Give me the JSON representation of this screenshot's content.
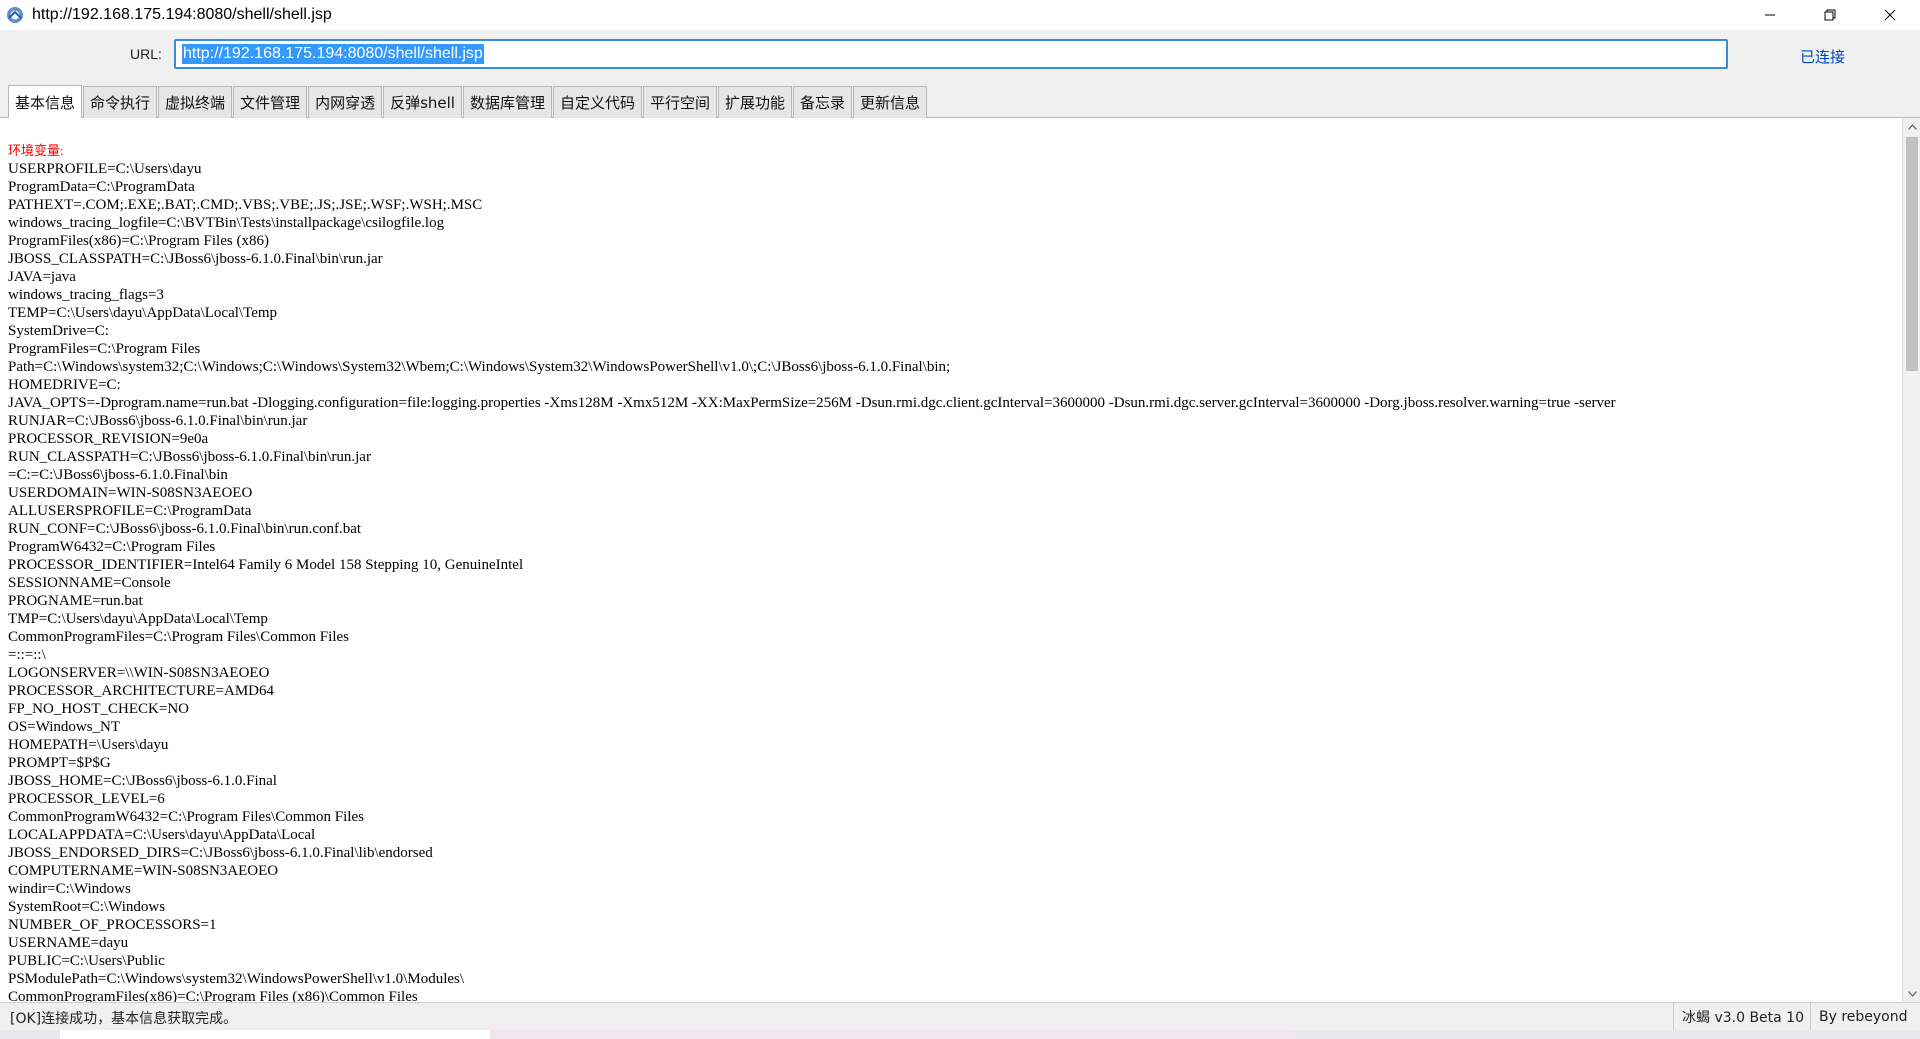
{
  "window": {
    "title": "http://192.168.175.194:8080/shell/shell.jsp"
  },
  "urlbar": {
    "label": "URL:",
    "value": "http://192.168.175.194:8080/shell/shell.jsp",
    "status": "已连接"
  },
  "tabs": [
    {
      "label": "基本信息",
      "active": true
    },
    {
      "label": "命令执行",
      "active": false
    },
    {
      "label": "虚拟终端",
      "active": false
    },
    {
      "label": "文件管理",
      "active": false
    },
    {
      "label": "内网穿透",
      "active": false
    },
    {
      "label": "反弹shell",
      "active": false
    },
    {
      "label": "数据库管理",
      "active": false
    },
    {
      "label": "自定义代码",
      "active": false
    },
    {
      "label": "平行空间",
      "active": false
    },
    {
      "label": "扩展功能",
      "active": false
    },
    {
      "label": "备忘录",
      "active": false
    },
    {
      "label": "更新信息",
      "active": false
    }
  ],
  "content": {
    "section_title": "环境变量:",
    "env_vars": [
      "USERPROFILE=C:\\Users\\dayu",
      "ProgramData=C:\\ProgramData",
      "PATHEXT=.COM;.EXE;.BAT;.CMD;.VBS;.VBE;.JS;.JSE;.WSF;.WSH;.MSC",
      "windows_tracing_logfile=C:\\BVTBin\\Tests\\installpackage\\csilogfile.log",
      "ProgramFiles(x86)=C:\\Program Files (x86)",
      "JBOSS_CLASSPATH=C:\\JBoss6\\jboss-6.1.0.Final\\bin\\run.jar",
      "JAVA=java",
      "windows_tracing_flags=3",
      "TEMP=C:\\Users\\dayu\\AppData\\Local\\Temp",
      "SystemDrive=C:",
      "ProgramFiles=C:\\Program Files",
      "Path=C:\\Windows\\system32;C:\\Windows;C:\\Windows\\System32\\Wbem;C:\\Windows\\System32\\WindowsPowerShell\\v1.0\\;C:\\JBoss6\\jboss-6.1.0.Final\\bin;",
      "HOMEDRIVE=C:",
      "JAVA_OPTS=-Dprogram.name=run.bat -Dlogging.configuration=file:logging.properties -Xms128M -Xmx512M -XX:MaxPermSize=256M -Dsun.rmi.dgc.client.gcInterval=3600000 -Dsun.rmi.dgc.server.gcInterval=3600000 -Dorg.jboss.resolver.warning=true -server",
      "RUNJAR=C:\\JBoss6\\jboss-6.1.0.Final\\bin\\run.jar",
      "PROCESSOR_REVISION=9e0a",
      "RUN_CLASSPATH=C:\\JBoss6\\jboss-6.1.0.Final\\bin\\run.jar",
      "=C:=C:\\JBoss6\\jboss-6.1.0.Final\\bin",
      "USERDOMAIN=WIN-S08SN3AEOEO",
      "ALLUSERSPROFILE=C:\\ProgramData",
      "RUN_CONF=C:\\JBoss6\\jboss-6.1.0.Final\\bin\\run.conf.bat",
      "ProgramW6432=C:\\Program Files",
      "PROCESSOR_IDENTIFIER=Intel64 Family 6 Model 158 Stepping 10, GenuineIntel",
      "SESSIONNAME=Console",
      "PROGNAME=run.bat",
      "TMP=C:\\Users\\dayu\\AppData\\Local\\Temp",
      "CommonProgramFiles=C:\\Program Files\\Common Files",
      "=::=::\\",
      "LOGONSERVER=\\\\WIN-S08SN3AEOEO",
      "PROCESSOR_ARCHITECTURE=AMD64",
      "FP_NO_HOST_CHECK=NO",
      "OS=Windows_NT",
      "HOMEPATH=\\Users\\dayu",
      "PROMPT=$P$G",
      "JBOSS_HOME=C:\\JBoss6\\jboss-6.1.0.Final",
      "PROCESSOR_LEVEL=6",
      "CommonProgramW6432=C:\\Program Files\\Common Files",
      "LOCALAPPDATA=C:\\Users\\dayu\\AppData\\Local",
      "JBOSS_ENDORSED_DIRS=C:\\JBoss6\\jboss-6.1.0.Final\\lib\\endorsed",
      "COMPUTERNAME=WIN-S08SN3AEOEO",
      "windir=C:\\Windows",
      "SystemRoot=C:\\Windows",
      "NUMBER_OF_PROCESSORS=1",
      "USERNAME=dayu",
      "PUBLIC=C:\\Users\\Public",
      "PSModulePath=C:\\Windows\\system32\\WindowsPowerShell\\v1.0\\Modules\\",
      "CommonProgramFiles(x86)=C:\\Program Files (x86)\\Common Files"
    ]
  },
  "statusbar": {
    "message": "[OK]连接成功，基本信息获取完成。",
    "version": "冰蝎 v3.0 Beta 10",
    "author": "By rebeyond"
  },
  "icons": {
    "app": "behinder-icon",
    "minimize": "minimize-icon",
    "restore": "restore-icon",
    "close": "close-icon"
  }
}
